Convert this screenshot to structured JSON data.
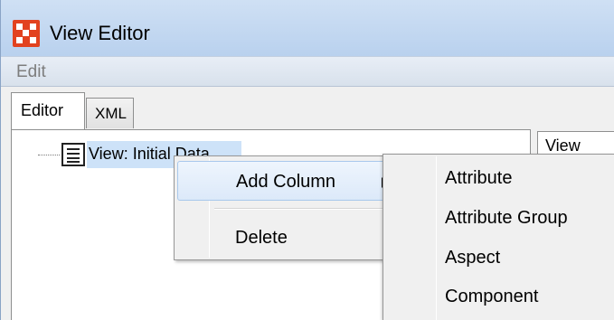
{
  "window": {
    "title": "View Editor",
    "app_icon": "app-logo-icon",
    "brand_color": "#e2421f"
  },
  "menubar": {
    "items": [
      "Edit"
    ]
  },
  "tabs": [
    {
      "label": "Editor",
      "selected": true
    },
    {
      "label": "XML",
      "selected": false
    }
  ],
  "tree": {
    "node_label": "View: Initial Data",
    "node_icon": "document-list-icon"
  },
  "side_field": {
    "value": "View"
  },
  "context_menu": {
    "items": [
      {
        "label": "Add Column",
        "has_submenu": true,
        "highlighted": true
      },
      {
        "label": "Delete",
        "has_submenu": false,
        "highlighted": false
      }
    ]
  },
  "submenu": {
    "items": [
      "Attribute",
      "Attribute Group",
      "Aspect",
      "Component"
    ]
  }
}
